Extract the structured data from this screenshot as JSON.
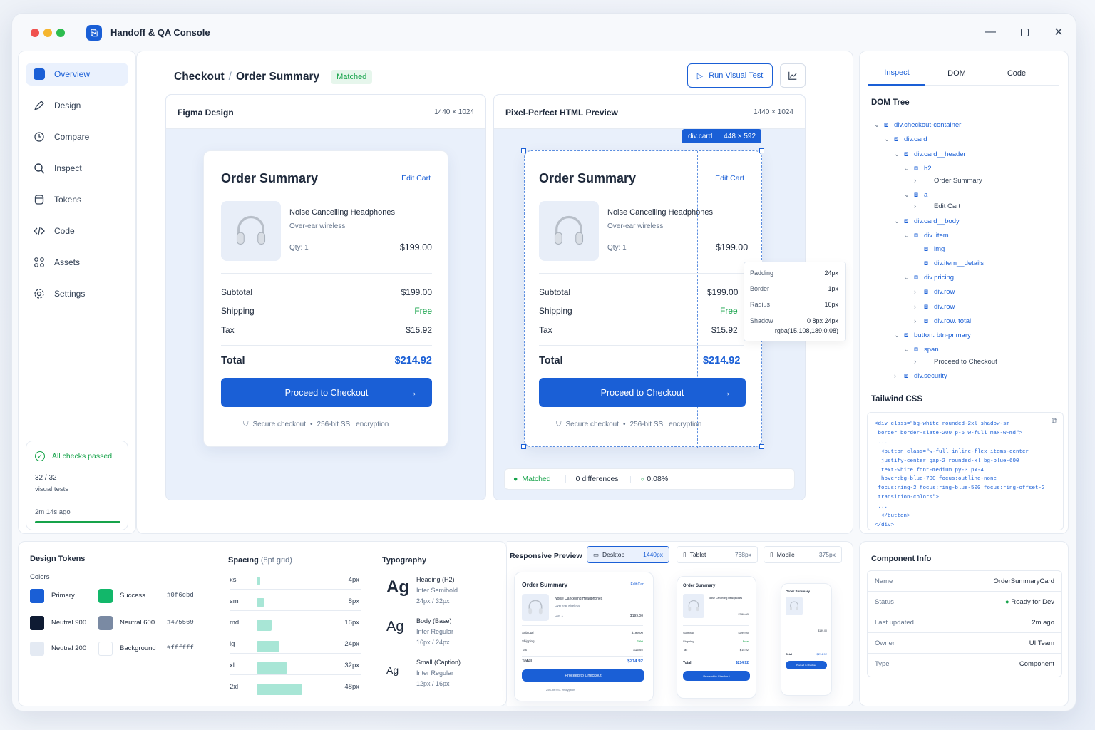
{
  "app": {
    "title": "Handoff & QA Console"
  },
  "sidebar": {
    "items": [
      {
        "label": "Overview"
      },
      {
        "label": "Design"
      },
      {
        "label": "Compare"
      },
      {
        "label": "Inspect"
      },
      {
        "label": "Tokens"
      },
      {
        "label": "Code"
      },
      {
        "label": "Assets"
      },
      {
        "label": "Settings"
      }
    ],
    "status": {
      "title": "All checks passed",
      "count": "32 / 32",
      "count_label": "visual tests",
      "time": "2m 14s ago"
    }
  },
  "header": {
    "breadcrumb_root": "Checkout",
    "breadcrumb_sep": "/",
    "breadcrumb_page": "Order Summary",
    "badge": "Matched",
    "run_button": "Run Visual Test"
  },
  "figma": {
    "title": "Figma Design",
    "size": "1440 × 1024"
  },
  "preview": {
    "title": "Pixel-Perfect HTML Preview",
    "size": "1440 × 1024",
    "selection_tag": "div.card",
    "selection_size": "448 × 592",
    "box_model": [
      {
        "k": "Padding",
        "v": "24px"
      },
      {
        "k": "Border",
        "v": "1px"
      },
      {
        "k": "Radius",
        "v": "16px"
      },
      {
        "k": "Shadow",
        "v": "0 8px 24px"
      },
      {
        "k": "",
        "v": "rgba(15,108,189,0.08)"
      }
    ],
    "status": {
      "matched": "Matched",
      "diff": "0 differences",
      "pct": "0.08%"
    }
  },
  "order": {
    "title": "Order Summary",
    "edit": "Edit Cart",
    "product": "Noise Cancelling Headphones",
    "variant": "Over-ear wireless",
    "qty": "Qty: 1",
    "price": "$199.00",
    "subtotal_label": "Subtotal",
    "subtotal": "$199.00",
    "shipping_label": "Shipping",
    "shipping": "Free",
    "tax_label": "Tax",
    "tax": "$15.92",
    "total_label": "Total",
    "total": "$214.92",
    "cta": "Proceed to Checkout",
    "secure": "Secure checkout",
    "secure_sep": "•",
    "ssl": "256-bit SSL encryption"
  },
  "inspect": {
    "tabs": [
      {
        "label": "Inspect"
      },
      {
        "label": "DOM"
      },
      {
        "label": "Code"
      }
    ],
    "dom_title": "DOM Tree",
    "dom": [
      "div.checkout-container",
      "div.card",
      "div.card__header",
      "h2",
      "Order Summary",
      "a",
      "Edit Cart",
      "div.card__body",
      "div. item",
      "img",
      "div.item__details",
      "div.pricing",
      "div.row",
      "div.row",
      "div.row. total",
      "button. btn-primary",
      "span",
      "Proceed to Checkout",
      "div.security"
    ],
    "css_title": "Tailwind CSS",
    "css_lines": [
      "<div class=\"bg-white rounded-2xl shadow-sm",
      " border border-slate-200 p-6 w-full max-w-md\">",
      " ...",
      "  <button class=\"w-full inline-flex items-center",
      "  justify-center gap-2 rounded-xl bg-blue-600",
      "  text-white font-medium py-3 px-4",
      "  hover:bg-blue-700 focus:outline-none",
      " focus:ring-2 focus:ring-blue-500 focus:ring-offset-2",
      " transition-colors\">",
      " ...",
      "  </button>",
      "</div>"
    ]
  },
  "tokens": {
    "title": "Design Tokens",
    "colors_label": "Colors",
    "colors": [
      {
        "name": "Primary",
        "hex": "",
        "color": "#1a5fd6"
      },
      {
        "name": "Success",
        "hex": "#0f6cbd",
        "color": "#12b76a"
      },
      {
        "name": "Neutral 900",
        "hex": "",
        "color": "#0f1b33"
      },
      {
        "name": "Neutral 600",
        "hex": "#475569",
        "color": "#7a8aa3"
      },
      {
        "name": "Neutral 200",
        "hex": "",
        "color": "#e4eaf3"
      },
      {
        "name": "Background",
        "hex": "#ffffff",
        "color": "#ffffff"
      }
    ],
    "spacing_title": "Spacing",
    "spacing_sub": "(8pt grid)",
    "spacing": [
      {
        "k": "xs",
        "v": "4px",
        "w": 4
      },
      {
        "k": "sm",
        "v": "8px",
        "w": 8
      },
      {
        "k": "md",
        "v": "16px",
        "w": 16
      },
      {
        "k": "lg",
        "v": "24px",
        "w": 24
      },
      {
        "k": "xl",
        "v": "32px",
        "w": 32
      },
      {
        "k": "2xl",
        "v": "48px",
        "w": 48
      }
    ],
    "type_title": "Typography",
    "type": [
      {
        "glyph": "Ag",
        "name": "Heading (H2)",
        "font": "Inter Semibold",
        "size": "24px / 32px"
      },
      {
        "glyph": "Ag",
        "name": "Body (Base)",
        "font": "Inter Regular",
        "size": "16px / 24px"
      },
      {
        "glyph": "Ag",
        "name": "Small (Caption)",
        "font": "Inter Regular",
        "size": "12px / 16px"
      }
    ]
  },
  "responsive": {
    "title": "Responsive Preview",
    "devices": [
      {
        "label": "Desktop",
        "size": "1440px"
      },
      {
        "label": "Tablet",
        "size": "768px"
      },
      {
        "label": "Mobile",
        "size": "375px"
      }
    ]
  },
  "component": {
    "title": "Component Info",
    "rows": [
      {
        "k": "Name",
        "v": "OrderSummaryCard"
      },
      {
        "k": "Status",
        "v": "Ready for Dev"
      },
      {
        "k": "Last updated",
        "v": "2m ago"
      },
      {
        "k": "Owner",
        "v": "UI Team"
      },
      {
        "k": "Type",
        "v": "Component"
      }
    ]
  }
}
